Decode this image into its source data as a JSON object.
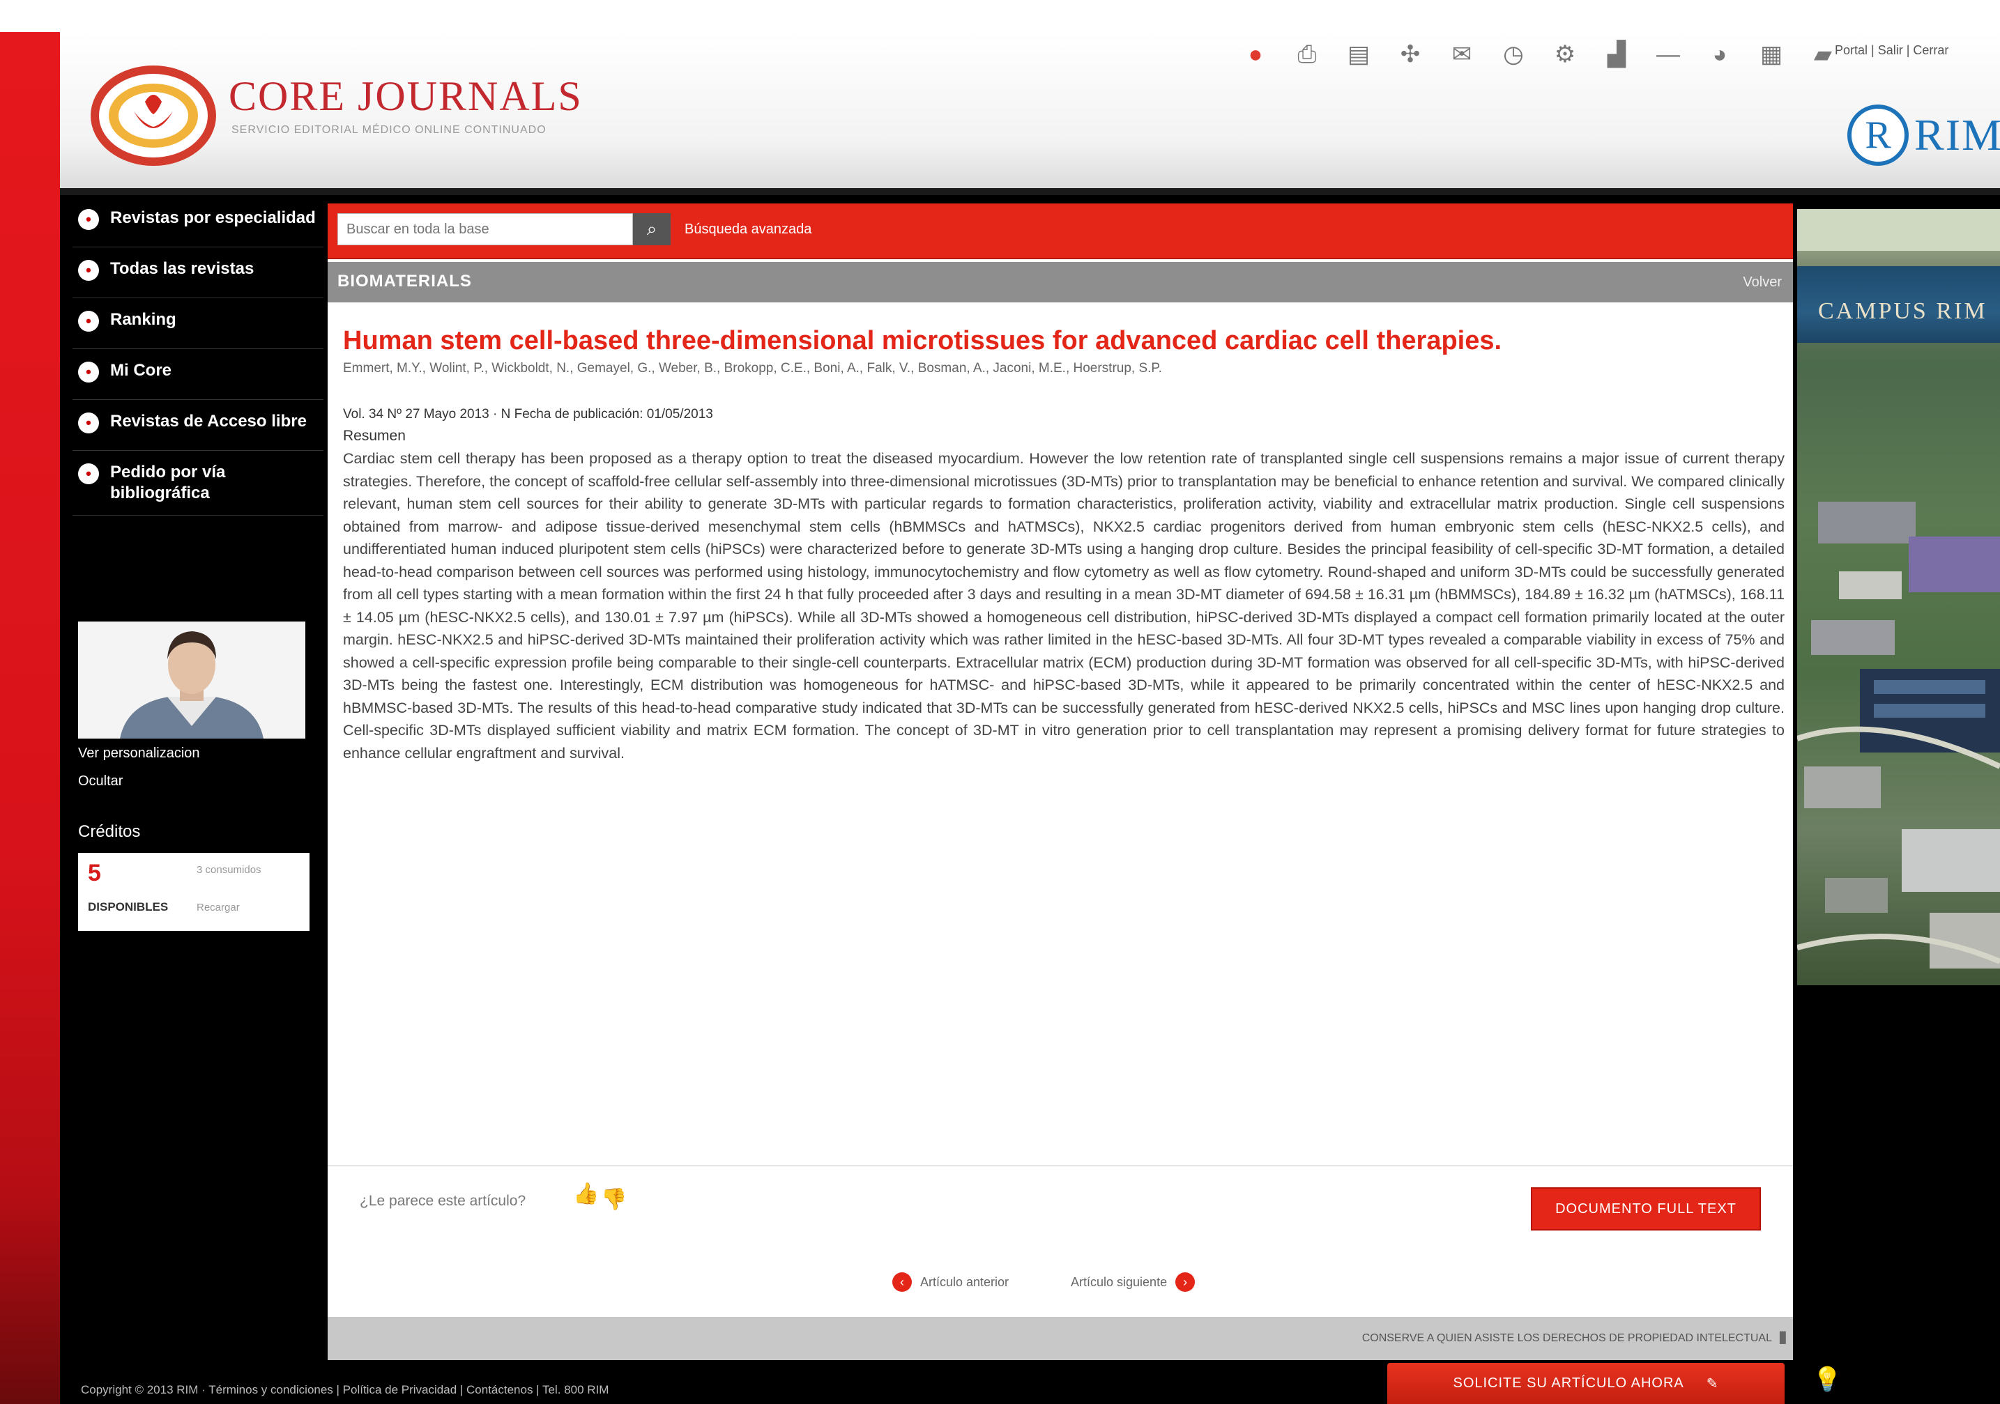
{
  "header": {
    "logo_title": "CORE JOURNALS",
    "logo_subtitle": "SERVICIO EDITORIAL MÉDICO ONLINE CONTINUADO",
    "top_icons": [
      {
        "name": "home-icon",
        "glyph": "●",
        "color": "#e0392d"
      },
      {
        "name": "print-icon",
        "glyph": "⎙"
      },
      {
        "name": "document-icon",
        "glyph": "▤"
      },
      {
        "name": "share-icon",
        "glyph": "✣"
      },
      {
        "name": "chat-icon",
        "glyph": "✉"
      },
      {
        "name": "clock-icon",
        "glyph": "◷"
      },
      {
        "name": "settings-icon",
        "glyph": "⚙"
      },
      {
        "name": "chart-icon",
        "glyph": "▟"
      },
      {
        "name": "minus-icon",
        "glyph": "—"
      },
      {
        "name": "globe-icon",
        "glyph": "◕"
      },
      {
        "name": "grid-icon",
        "glyph": "▦"
      },
      {
        "name": "folder-icon",
        "glyph": "▰"
      }
    ],
    "user_links": "Portal | Salir | Cerrar",
    "partner_logo": "RIM",
    "partner_initial": "R"
  },
  "sidebar": {
    "items": [
      {
        "label": "Revistas por especialidad"
      },
      {
        "label": "Todas las revistas"
      },
      {
        "label": "Ranking"
      },
      {
        "label": "Mi Core"
      },
      {
        "label": "Revistas de Acceso libre"
      },
      {
        "label": "Pedido por vía bibliográfica"
      }
    ],
    "profile_link": "Ver personalizacion",
    "logout": "Ocultar",
    "credits_title": "Créditos",
    "credits_value": "5",
    "credits_label": "DISPONIBLES",
    "credits_info1": "3 consumidos",
    "credits_info2": "Recargar"
  },
  "search": {
    "placeholder": "Buscar en toda la base",
    "advanced": "Búsqueda avanzada"
  },
  "section": {
    "title": "BIOMATERIALS",
    "back": "Volver"
  },
  "article": {
    "title": "Human stem cell-based three-dimensional microtissues for advanced cardiac cell therapies.",
    "authors": "Emmert, M.Y., Wolint, P., Wickboldt, N., Gemayel, G., Weber, B., Brokopp, C.E., Boni, A., Falk, V., Bosman, A., Jaconi, M.E., Hoerstrup, S.P.",
    "meta": "Vol. 34 Nº 27 Mayo 2013 · N Fecha de publicación: 01/05/2013",
    "abstract_label": "Resumen",
    "abstract": "Cardiac stem cell therapy has been proposed as a therapy option to treat the diseased myocardium. However the low retention rate of transplanted single cell suspensions remains a major issue of current therapy strategies. Therefore, the concept of scaffold-free cellular self-assembly into three-dimensional microtissues (3D-MTs) prior to transplantation may be beneficial to enhance retention and survival. We compared clinically relevant, human stem cell sources for their ability to generate 3D-MTs with particular regards to formation characteristics, proliferation activity, viability and extracellular matrix production. Single cell suspensions obtained from marrow- and adipose tissue-derived mesenchymal stem cells (hBMMSCs and hATMSCs), NKX2.5 cardiac progenitors derived from human embryonic stem cells (hESC-NKX2.5 cells), and undifferentiated human induced pluripotent stem cells (hiPSCs) were characterized before to generate 3D-MTs using a hanging drop culture. Besides the principal feasibility of cell-specific 3D-MT formation, a detailed head-to-head comparison between cell sources was performed using histology, immunocytochemistry and flow cytometry as well as flow cytometry. Round-shaped and uniform 3D-MTs could be successfully generated from all cell types starting with a mean formation within the first 24 h that fully proceeded after 3 days and resulting in a mean 3D-MT diameter of 694.58 ± 16.31 µm (hBMMSCs), 184.89 ± 16.32 µm (hATMSCs), 168.11 ± 14.05 µm (hESC-NKX2.5 cells), and 130.01 ± 7.97 µm (hiPSCs). While all 3D-MTs showed a homogeneous cell distribution, hiPSC-derived 3D-MTs displayed a compact cell formation primarily located at the outer margin. hESC-NKX2.5 and hiPSC-derived 3D-MTs maintained their proliferation activity which was rather limited in the hESC-based 3D-MTs. All four 3D-MT types revealed a comparable viability in excess of 75% and showed a cell-specific expression profile being comparable to their single-cell counterparts. Extracellular matrix (ECM) production during 3D-MT formation was observed for all cell-specific 3D-MTs, with hiPSC-derived 3D-MTs being the fastest one. Interestingly, ECM distribution was homogeneous for hATMSC- and hiPSC-based 3D-MTs, while it appeared to be primarily concentrated within the center of hESC-NKX2.5 and hBMMSC-based 3D-MTs. The results of this head-to-head comparative study indicated that 3D-MTs can be successfully generated from hESC-derived NKX2.5 cells, hiPSCs and MSC lines upon hanging drop culture. Cell-specific 3D-MTs displayed sufficient viability and matrix ECM formation. The concept of 3D-MT in vitro generation prior to cell transplantation may represent a promising delivery format for future strategies to enhance cellular engraftment and survival."
  },
  "actions": {
    "useful_question": "¿Le parece este artículo?",
    "fulltext_button": "DOCUMENTO FULL TEXT",
    "prev": "Artículo anterior",
    "next": "Artículo siguiente",
    "copyright_notice": "CONSERVE A QUIEN ASISTE LOS DERECHOS DE PROPIEDAD INTELECTUAL"
  },
  "banner": {
    "title": "CAMPUS RIM"
  },
  "footer": {
    "copyright": "Copyright © 2013 RIM · Términos y condiciones | Política de Privacidad | Contáctenos | Tel. 800 RIM",
    "request_button": "SOLICITE SU ARTÍCULO AHORA",
    "request_icon": "✎",
    "bulb_icon": "💡"
  }
}
